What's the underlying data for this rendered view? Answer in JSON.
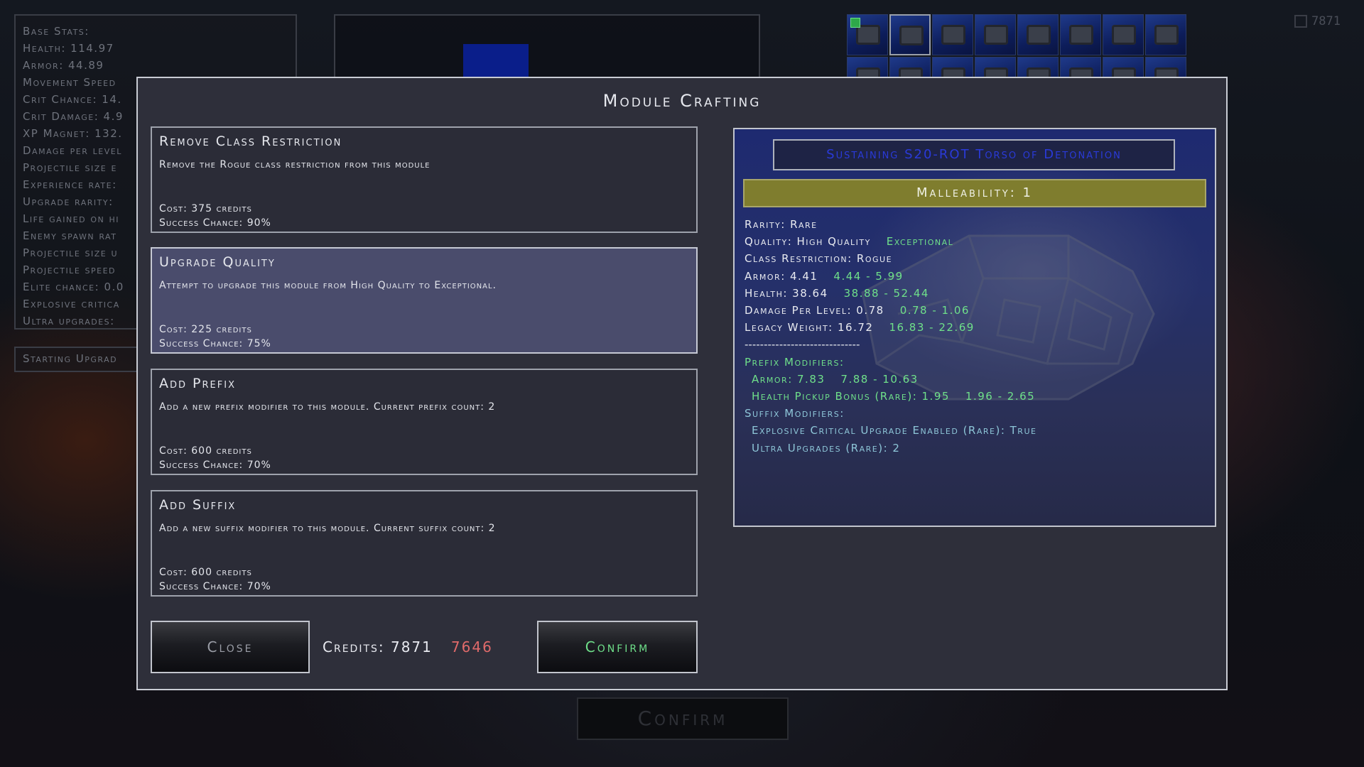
{
  "background": {
    "stats": [
      "Base Stats:",
      "Health: 114.97",
      "Armor: 44.89",
      "Movement Speed",
      "Crit Chance: 14.",
      "Crit Damage: 4.9",
      "XP Magnet: 132.",
      "Damage per level",
      "Projectile size e",
      "Experience rate:",
      "Upgrade rarity:",
      "Life gained on hi",
      "Enemy spawn rat",
      "Projectile size u",
      "Projectile speed",
      "Elite chance: 0.0",
      "Explosive critica",
      "Ultra upgrades:"
    ],
    "starting_upgrades_label": "Starting Upgrad",
    "currency": "7871",
    "confirm_label": "Confirm",
    "inventory_slot_count": 16
  },
  "dialog": {
    "title": "Module Crafting",
    "options": [
      {
        "title": "Remove Class Restriction",
        "description": "Remove the Rogue class restriction from this module",
        "cost": "Cost: 375 credits",
        "chance": "Success Chance: 90%",
        "selected": false
      },
      {
        "title": "Upgrade Quality",
        "description": "Attempt to upgrade this module from High Quality to Exceptional.",
        "cost": "Cost: 225 credits",
        "chance": "Success Chance: 75%",
        "selected": true
      },
      {
        "title": "Add Prefix",
        "description": "Add a new prefix modifier to this module. Current prefix count: 2",
        "cost": "Cost: 600 credits",
        "chance": "Success Chance: 70%",
        "selected": false
      },
      {
        "title": "Add Suffix",
        "description": "Add a new suffix modifier to this module. Current suffix count: 2",
        "cost": "Cost: 600 credits",
        "chance": "Success Chance: 70%",
        "selected": false
      }
    ],
    "close_label": "Close",
    "confirm_label": "Confirm",
    "credits_label": "Credits: 7871",
    "credits_after": "7646"
  },
  "item": {
    "name": "Sustaining S20-ROT Torso of Detonation",
    "malleability": "Malleability: 1",
    "rarity": "Rarity: Rare",
    "quality": "Quality: High Quality",
    "quality_next": "Exceptional",
    "class_restriction": "Class Restriction: Rogue",
    "stats": [
      {
        "label": "Armor: 4.41",
        "range": "4.44 - 5.99"
      },
      {
        "label": "Health: 38.64",
        "range": "38.88 - 52.44"
      },
      {
        "label": "Damage Per Level: 0.78",
        "range": "0.78 - 1.06"
      },
      {
        "label": "Legacy Weight: 16.72",
        "range": "16.83 - 22.69"
      }
    ],
    "divider": "------------------------------",
    "prefix_header": "Prefix Modifiers:",
    "prefixes": [
      {
        "label": "Armor: 7.83",
        "range": "7.88 - 10.63"
      },
      {
        "label": "Health Pickup Bonus (Rare): 1.95",
        "range": "1.96 - 2.65"
      }
    ],
    "suffix_header": "Suffix Modifiers:",
    "suffixes": [
      "Explosive Critical Upgrade Enabled (Rare): True",
      "Ultra Upgrades (Rare): 2"
    ],
    "colors": {
      "name": "#2a3ad8",
      "malleability_bar": "#7f7d2e",
      "positive": "#6fe08a",
      "suffix": "#8ec6d8"
    }
  }
}
